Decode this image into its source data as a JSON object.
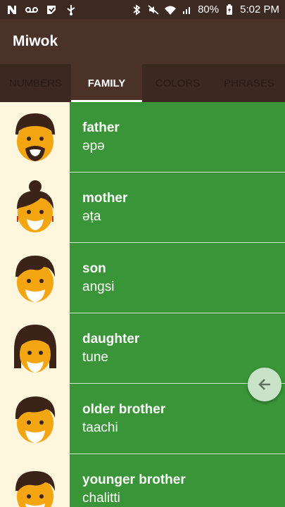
{
  "status_bar": {
    "battery": "80%",
    "time": "5:02 PM",
    "left_icons": [
      "n-icon",
      "voicemail-icon",
      "app-icon",
      "usb-icon"
    ],
    "right_icons": [
      "bluetooth-icon",
      "mute-icon",
      "wifi-icon",
      "signal-icon",
      "battery-icon"
    ]
  },
  "appbar": {
    "title": "Miwok"
  },
  "tabs": [
    {
      "label": "NUMBERS",
      "active": false
    },
    {
      "label": "FAMILY",
      "active": true
    },
    {
      "label": "COLORS",
      "active": false
    },
    {
      "label": "PHRASES",
      "active": false
    }
  ],
  "items": [
    {
      "word": "father",
      "translation": "әpә",
      "icon": "father-icon"
    },
    {
      "word": "mother",
      "translation": "әṭa",
      "icon": "mother-icon"
    },
    {
      "word": "son",
      "translation": "angsi",
      "icon": "son-icon"
    },
    {
      "word": "daughter",
      "translation": "tune",
      "icon": "daughter-icon"
    },
    {
      "word": "older brother",
      "translation": "taachi",
      "icon": "older-brother-icon"
    },
    {
      "word": "younger brother",
      "translation": "chalitti",
      "icon": "younger-brother-icon"
    }
  ],
  "fab": {
    "icon": "back-arrow-icon"
  },
  "colors": {
    "statusbar": "#3c2a22",
    "appbar": "#4a3229",
    "tabbar": "#3f2b23",
    "row": "#399537",
    "thumb_bg": "#fef6dd",
    "face": "#f4a612",
    "hair": "#3b2417"
  }
}
